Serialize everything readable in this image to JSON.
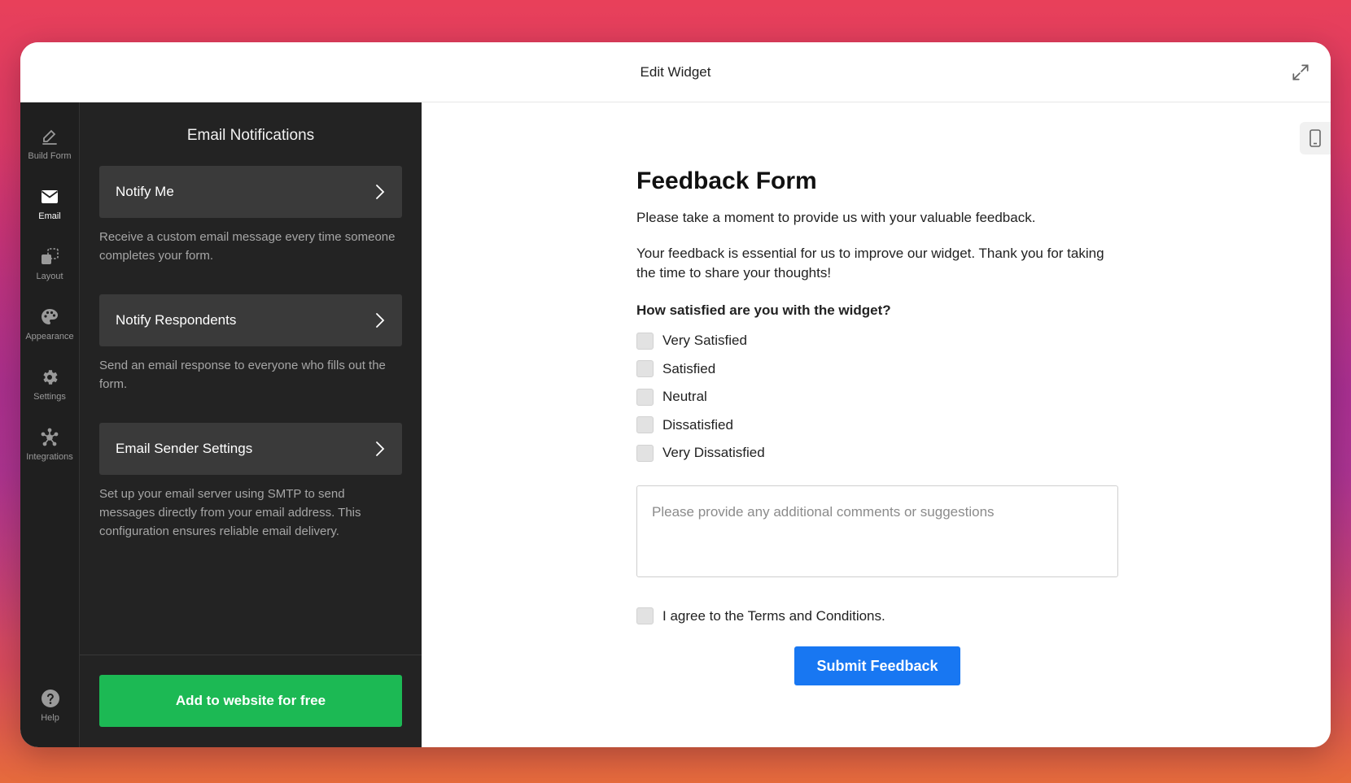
{
  "window": {
    "title": "Edit Widget",
    "expand_icon": "expand-icon"
  },
  "rail": {
    "items": [
      {
        "label": "Build Form",
        "icon": "pencil-icon"
      },
      {
        "label": "Email",
        "icon": "envelope-icon",
        "active": true
      },
      {
        "label": "Layout",
        "icon": "layout-icon"
      },
      {
        "label": "Appearance",
        "icon": "palette-icon"
      },
      {
        "label": "Settings",
        "icon": "gear-icon"
      },
      {
        "label": "Integrations",
        "icon": "integrations-icon"
      }
    ],
    "help": {
      "label": "Help",
      "icon": "question-icon"
    }
  },
  "panel": {
    "title": "Email Notifications",
    "cards": [
      {
        "label": "Notify Me",
        "desc": "Receive a custom email message every time someone completes your form."
      },
      {
        "label": "Notify Respondents",
        "desc": "Send an email response to everyone who fills out the form."
      },
      {
        "label": "Email Sender Settings",
        "desc": "Set up your email server using SMTP to send messages directly from your email address. This configuration ensures reliable email delivery."
      }
    ],
    "add_button": "Add to website for free"
  },
  "form": {
    "title": "Feedback Form",
    "intro": "Please take a moment to provide us with your valuable feedback.",
    "intro2": "Your feedback is essential for us to improve our widget. Thank you for taking the time to share your thoughts!",
    "question": "How satisfied are you with the widget?",
    "options": [
      "Very Satisfied",
      "Satisfied",
      "Neutral",
      "Dissatisfied",
      "Very Dissatisfied"
    ],
    "comments_placeholder": "Please provide any additional comments or suggestions",
    "terms": "I agree to the Terms and Conditions.",
    "submit": "Submit Feedback"
  },
  "colors": {
    "accent_green": "#1cb954",
    "submit_blue": "#1877f2",
    "panel_bg": "#232323"
  }
}
